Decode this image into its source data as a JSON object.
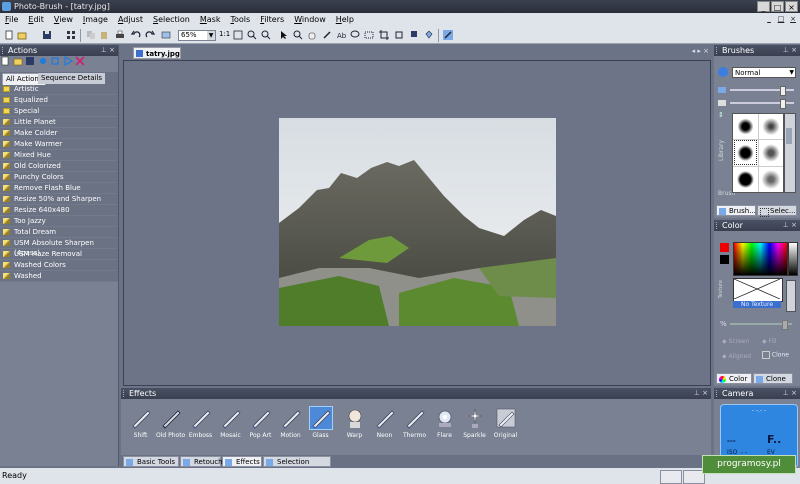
{
  "window": {
    "title": "Photo-Brush - [tatry.jpg]",
    "controls": [
      "_",
      "□",
      "×"
    ]
  },
  "menu": [
    "File",
    "Edit",
    "View",
    "Image",
    "Adjust",
    "Selection",
    "Mask",
    "Tools",
    "Filters",
    "Window",
    "Help"
  ],
  "mdi_controls": [
    "_",
    "□",
    "×"
  ],
  "toolbar": {
    "zoom": "65%",
    "one_to_one": "1:1"
  },
  "actions": {
    "title": "Actions",
    "tabs": [
      "All Actions",
      "Sequence Details"
    ],
    "folders": [
      "Artistic",
      "Equalized",
      "Special"
    ],
    "items": [
      "Little Planet",
      "Make Colder",
      "Make Warmer",
      "Mixed Hue",
      "Old Colorized",
      "Punchy Colors",
      "Remove Flash Blue",
      "Resize 50% and Sharpen",
      "Resize 640x480",
      "Too Jazzy",
      "Total Dream",
      "USM Absolute Sharpen (4pass)",
      "USM Haze Removal",
      "Washed Colors",
      "Washed"
    ]
  },
  "document": {
    "tab": "tatry.jpg"
  },
  "brushes": {
    "title": "Brushes",
    "mode": "Normal",
    "side_labels": [
      "Library",
      "Brush"
    ],
    "tabs": [
      "Brush...",
      "Selec..."
    ]
  },
  "color": {
    "title": "Color",
    "texture_label": "Texture",
    "no_texture": "No Texture",
    "options": [
      "Screen",
      "Fill",
      "Aligned",
      "Clone"
    ],
    "tabs": [
      "Color",
      "Clone"
    ]
  },
  "camera": {
    "title": "Camera",
    "readout_top": "- -.- -",
    "dashes": "---",
    "f_label": "F..",
    "iso": "ISO",
    "iso_value": "- -",
    "ev": "EV",
    "bottom": "- - - - -"
  },
  "effects": {
    "title": "Effects",
    "items": [
      "Shift",
      "Old Photo",
      "Emboss",
      "Mosaic",
      "Pop Art",
      "Motion",
      "Glass",
      "Warp",
      "Neon",
      "Thermo",
      "Flare",
      "Sparkle",
      "Original"
    ],
    "selected": "Glass",
    "tabs": [
      "Basic Tools",
      "Retouch",
      "Effects",
      "Selection Tools"
    ]
  },
  "status": {
    "text": "Ready"
  },
  "watermark": "programosy.pl"
}
